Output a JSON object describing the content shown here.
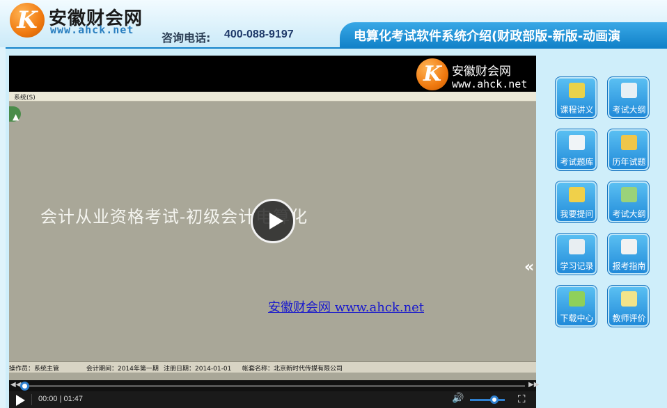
{
  "header": {
    "brand": "安徽财会网",
    "domain": "www.ahck.net",
    "logo_mark": "K",
    "hotline_label": "咨询电话:",
    "hotline": "400-088-9197",
    "title": "电算化考试软件系统介绍(财政部版-新版-动画演"
  },
  "video": {
    "watermark_brand": "安徽财会网",
    "watermark_domain": "www.ahck.net",
    "menu": "系统(S)",
    "main_caption": "会计从业资格考试-初级会计电算化",
    "link_caption": "安徽财会网 www.ahck.net",
    "status": {
      "operator": "操作员：系统主管",
      "period": "会计期间：2014年第一期",
      "login_date": "注册日期：2014-01-01",
      "account": "帐套名称：北京新时代传媒有限公司"
    },
    "collapse_glyph": "«"
  },
  "controls": {
    "time": "00:00 | 01:47",
    "progress": 0.0,
    "volume": 0.7
  },
  "side_buttons": [
    {
      "label": "课程讲义",
      "icon": "notebook-check-icon",
      "color": "#e9d24a"
    },
    {
      "label": "考试大纲",
      "icon": "document-pen-icon",
      "color": "#e6f0f5"
    },
    {
      "label": "考试题库",
      "icon": "calendar-icon",
      "color": "#f0f4f7"
    },
    {
      "label": "历年试题",
      "icon": "folder-chart-icon",
      "color": "#efc64a"
    },
    {
      "label": "我要提问",
      "icon": "help-bulb-icon",
      "color": "#f0d04a"
    },
    {
      "label": "考试大纲",
      "icon": "document-list-icon",
      "color": "#9ad27a"
    },
    {
      "label": "学习记录",
      "icon": "spreadsheet-icon",
      "color": "#e8eef2"
    },
    {
      "label": "报考指南",
      "icon": "clipboard-chart-icon",
      "color": "#f2f2f2"
    },
    {
      "label": "下载中心",
      "icon": "database-icon",
      "color": "#8fd05a"
    },
    {
      "label": "教师评价",
      "icon": "chat-bubbles-icon",
      "color": "#f2e48a"
    }
  ]
}
